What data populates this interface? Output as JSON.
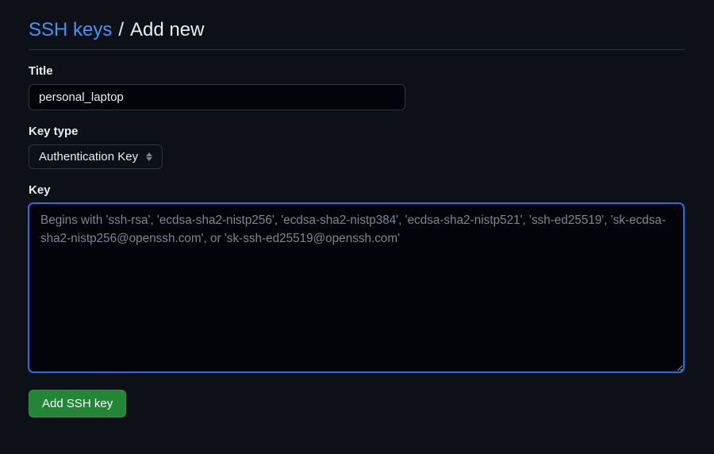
{
  "header": {
    "breadcrumb_link": "SSH keys",
    "separator": "/",
    "page_title": "Add new"
  },
  "form": {
    "title": {
      "label": "Title",
      "value": "personal_laptop"
    },
    "key_type": {
      "label": "Key type",
      "selected": "Authentication Key"
    },
    "key": {
      "label": "Key",
      "value": "",
      "placeholder": "Begins with 'ssh-rsa', 'ecdsa-sha2-nistp256', 'ecdsa-sha2-nistp384', 'ecdsa-sha2-nistp521', 'ssh-ed25519', 'sk-ecdsa-sha2-nistp256@openssh.com', or 'sk-ssh-ed25519@openssh.com'"
    },
    "submit_label": "Add SSH key"
  }
}
